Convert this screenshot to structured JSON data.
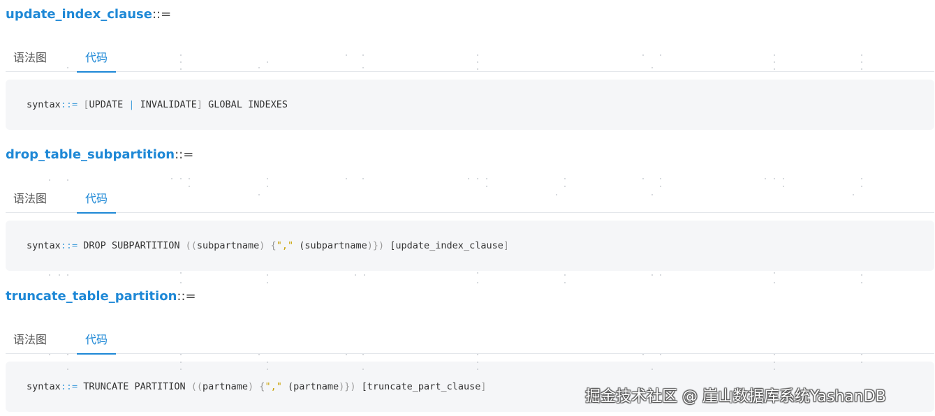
{
  "sections": [
    {
      "title": "update_index_clause",
      "separator": "::=",
      "tabs": {
        "syntax": "语法图",
        "code": "代码"
      },
      "code": {
        "prefix": "syntax",
        "op": "::=",
        "tokens": [
          {
            "t": " "
          },
          {
            "t": "[",
            "c": "br"
          },
          {
            "t": "UPDATE "
          },
          {
            "t": "|",
            "c": "op"
          },
          {
            "t": " INVALIDATE"
          },
          {
            "t": "]",
            "c": "br"
          },
          {
            "t": " GLOBAL INDEXES"
          }
        ]
      }
    },
    {
      "title": "drop_table_subpartition",
      "separator": "::=",
      "tabs": {
        "syntax": "语法图",
        "code": "代码"
      },
      "code": {
        "prefix": "syntax",
        "op": "::=",
        "tokens": [
          {
            "t": " DROP SUBPARTITION "
          },
          {
            "t": "((",
            "c": "par"
          },
          {
            "t": "subpartname"
          },
          {
            "t": ")",
            "c": "par"
          },
          {
            "t": " {",
            "c": "br"
          },
          {
            "t": "\",\"",
            "c": "str"
          },
          {
            "t": " ("
          },
          {
            "t": "subpartname"
          },
          {
            "t": ")})",
            "c": "par"
          },
          {
            "t": " ["
          },
          {
            "t": "update_index_clause"
          },
          {
            "t": "]",
            "c": "br"
          }
        ]
      }
    },
    {
      "title": "truncate_table_partition",
      "separator": "::=",
      "tabs": {
        "syntax": "语法图",
        "code": "代码"
      },
      "code": {
        "prefix": "syntax",
        "op": "::=",
        "tokens": [
          {
            "t": " TRUNCATE PARTITION "
          },
          {
            "t": "((",
            "c": "par"
          },
          {
            "t": "partname"
          },
          {
            "t": ")",
            "c": "par"
          },
          {
            "t": " {",
            "c": "br"
          },
          {
            "t": "\",\"",
            "c": "str"
          },
          {
            "t": " ("
          },
          {
            "t": "partname"
          },
          {
            "t": ")})",
            "c": "par"
          },
          {
            "t": " ["
          },
          {
            "t": "truncate_part_clause"
          },
          {
            "t": "]",
            "c": "br"
          }
        ]
      }
    }
  ],
  "watermark": "掘金技术社区 @ 崖山数据库系统YashanDB"
}
